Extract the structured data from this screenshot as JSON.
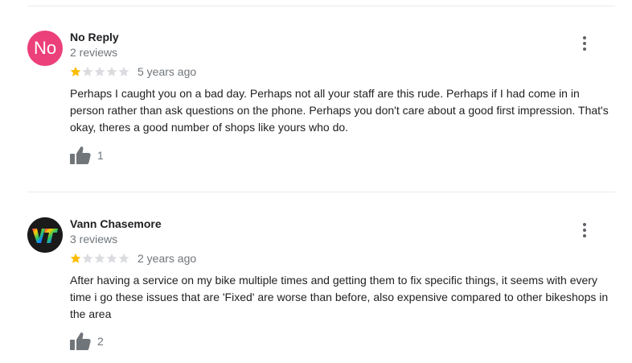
{
  "reviews": [
    {
      "author": "No Reply",
      "avatar_initials": "No",
      "avatar_color": "#ec407a",
      "author_meta": "2 reviews",
      "rating": 1,
      "max_rating": 5,
      "time": "5 years ago",
      "text": "Perhaps I  caught you on a bad day.  Perhaps not all your staff are this rude.  Perhaps if I had come in in person rather than ask questions on the phone.  Perhaps you don't care about a good first impression.  That's okay, theres a good number of shops like yours who do.",
      "likes": "1"
    },
    {
      "author": "Vann Chasemore",
      "avatar_color": "#1a1a1a",
      "author_meta": "3 reviews",
      "rating": 1,
      "max_rating": 5,
      "time": "2 years ago",
      "text": "After having a service on my bike multiple times and getting them to fix specific things, it seems with every time i go these issues that are 'Fixed' are worse than before, also expensive compared to other bikeshops in the area",
      "likes": "2"
    }
  ],
  "icons": {
    "star_filled_color": "#fbbc04",
    "star_empty_color": "#dadce0",
    "thumb_color": "#70757a",
    "more": "more-vert-icon"
  }
}
